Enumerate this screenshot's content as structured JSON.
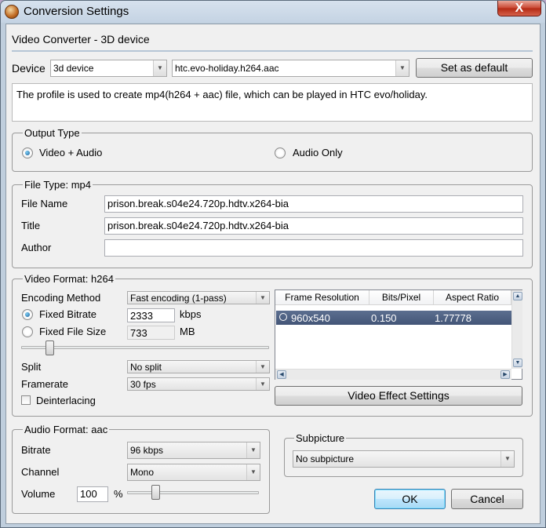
{
  "window": {
    "title": "Conversion Settings",
    "close_glyph": "X"
  },
  "header": {
    "title": "Video Converter - 3D device"
  },
  "device": {
    "label": "Device",
    "device_value": "3d device",
    "profile_value": "htc.evo-holiday.h264.aac",
    "set_default_label": "Set as default",
    "description": "The profile is used to create mp4(h264 + aac) file, which can be played in HTC evo/holiday."
  },
  "output_type": {
    "title": "Output Type",
    "video_audio_label": "Video + Audio",
    "audio_only_label": "Audio Only",
    "selected": "video_audio"
  },
  "file_type": {
    "title": "File Type: mp4",
    "file_name_label": "File Name",
    "file_name_value": "prison.break.s04e24.720p.hdtv.x264-bia",
    "title_label": "Title",
    "title_value": "prison.break.s04e24.720p.hdtv.x264-bia",
    "author_label": "Author",
    "author_value": ""
  },
  "video_format": {
    "title": "Video Format: h264",
    "encoding_label": "Encoding Method",
    "encoding_value": "Fast encoding (1-pass)",
    "fixed_bitrate_label": "Fixed Bitrate",
    "bitrate_value": "2333",
    "bitrate_unit": "kbps",
    "fixed_size_label": "Fixed File Size",
    "size_value": "733",
    "size_unit": "MB",
    "slider_level": 0.1,
    "split_label": "Split",
    "split_value": "No split",
    "framerate_label": "Framerate",
    "framerate_value": "30 fps",
    "deinterlacing_label": "Deinterlacing",
    "deinterlacing_checked": false,
    "table": {
      "columns": [
        "Frame Resolution",
        "Bits/Pixel",
        "Aspect Ratio"
      ],
      "rows": [
        [
          "960x540",
          "0.150",
          "1.77778"
        ]
      ]
    },
    "effect_settings_label": "Video Effect Settings"
  },
  "audio_format": {
    "title": "Audio Format: aac",
    "bitrate_label": "Bitrate",
    "bitrate_value": "96 kbps",
    "channel_label": "Channel",
    "channel_value": "Mono",
    "volume_label": "Volume",
    "volume_value": "100",
    "volume_unit": "%"
  },
  "subpicture": {
    "title": "Subpicture",
    "value": "No subpicture"
  },
  "buttons": {
    "ok_label": "OK",
    "cancel_label": "Cancel"
  },
  "colors": {
    "selection": "#4b5e80",
    "close_red": "#c8442f",
    "frame": "#c4d3e3"
  }
}
